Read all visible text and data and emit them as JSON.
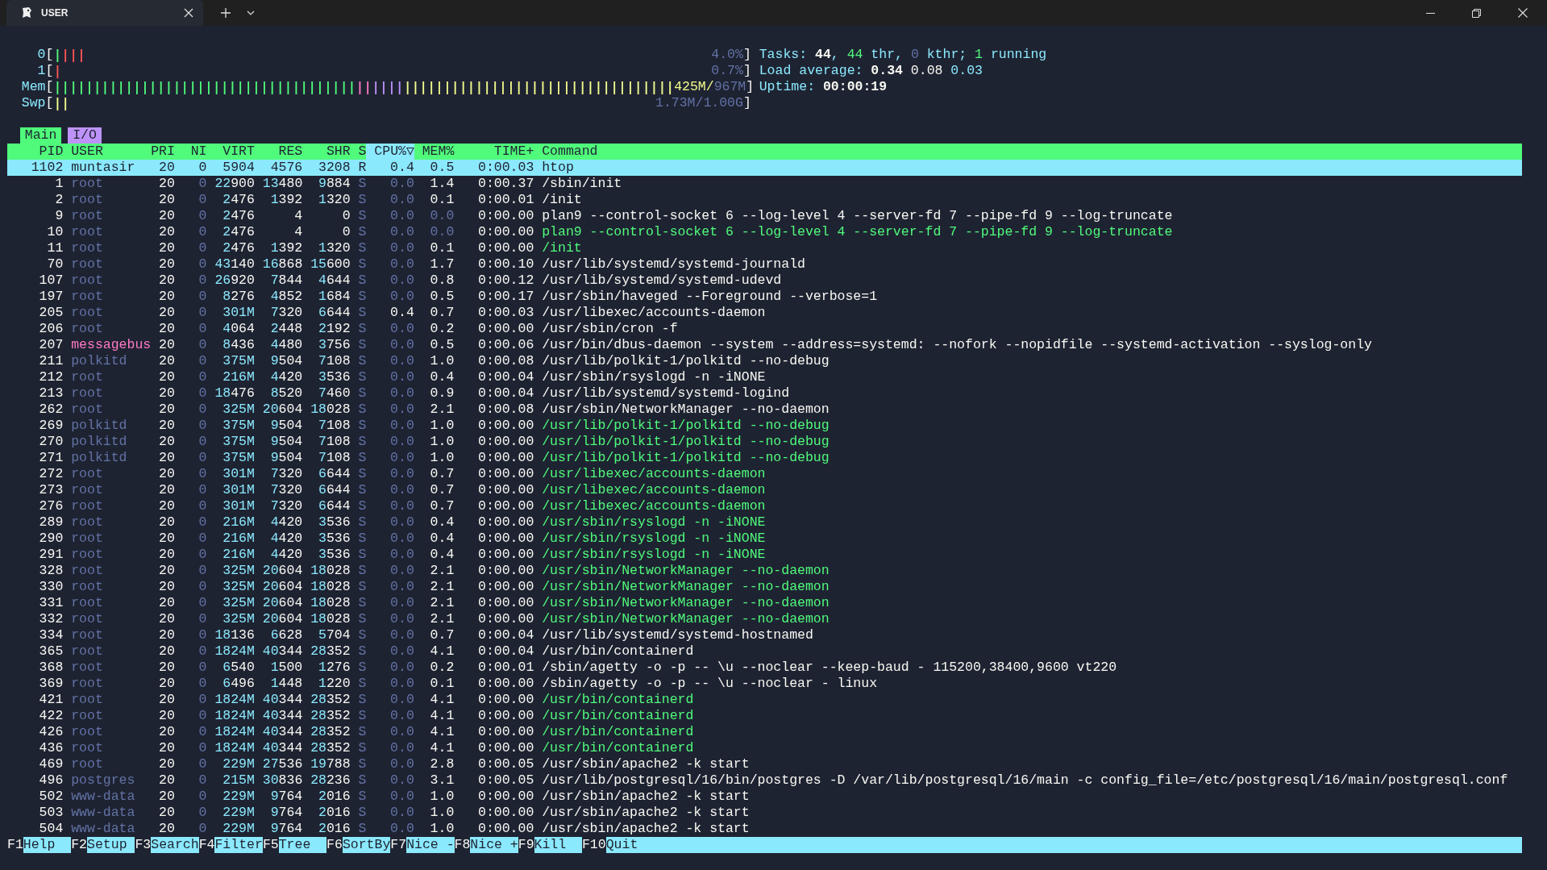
{
  "window": {
    "tab_title": "USER"
  },
  "meters": [
    {
      "label_parts": [
        {
          "text": "0",
          "color": "#8be9fd"
        },
        {
          "text": "[",
          "color": "#f8f8f2"
        }
      ],
      "bar_parts": [
        {
          "text": "|",
          "color": "#50fa7b"
        },
        {
          "text": "|||",
          "color": "#ff5555"
        }
      ],
      "value_parts": [
        {
          "text": "4.0%",
          "color": "#6272a4"
        },
        {
          "text": "]",
          "color": "#f8f8f2"
        }
      ]
    },
    {
      "label_parts": [
        {
          "text": "1",
          "color": "#8be9fd"
        },
        {
          "text": "[",
          "color": "#f8f8f2"
        }
      ],
      "bar_parts": [
        {
          "text": "|",
          "color": "#ff5555"
        }
      ],
      "value_parts": [
        {
          "text": "0.7%",
          "color": "#6272a4"
        },
        {
          "text": "]",
          "color": "#f8f8f2"
        }
      ]
    },
    {
      "label_parts": [
        {
          "text": "Mem",
          "color": "#8be9fd"
        },
        {
          "text": "[",
          "color": "#f8f8f2"
        }
      ],
      "bar_parts": [
        {
          "text": "||||||||||||||||||||||||||||||||||||||",
          "color": "#50fa7b"
        },
        {
          "text": "||",
          "color": "#ff79c6"
        },
        {
          "text": "||||",
          "color": "#bd93f9"
        },
        {
          "text": "||||||||||||||||||||||||||||||||||",
          "color": "#f1fa8c"
        }
      ],
      "value_parts": [
        {
          "text": "425M/",
          "color": "#f1fa8c"
        },
        {
          "text": "967M",
          "color": "#6272a4"
        },
        {
          "text": "]",
          "color": "#f8f8f2"
        }
      ]
    },
    {
      "label_parts": [
        {
          "text": "Swp",
          "color": "#8be9fd"
        },
        {
          "text": "[",
          "color": "#f8f8f2"
        }
      ],
      "bar_parts": [
        {
          "text": "||",
          "color": "#f1fa8c"
        }
      ],
      "value_parts": [
        {
          "text": "1.73M/1.00G",
          "color": "#6272a4"
        },
        {
          "text": "]",
          "color": "#f8f8f2"
        }
      ]
    }
  ],
  "info_lines": [
    [
      {
        "text": "Tasks: ",
        "color": "#8be9fd"
      },
      {
        "text": "44",
        "color": "#f8f8f2"
      },
      {
        "text": ", ",
        "color": "#8be9fd"
      },
      {
        "text": "44",
        "color": "#50fa7b"
      },
      {
        "text": " thr, ",
        "color": "#8be9fd"
      },
      {
        "text": "0",
        "color": "#6272a4"
      },
      {
        "text": " kthr; ",
        "color": "#8be9fd"
      },
      {
        "text": "1",
        "color": "#50fa7b"
      },
      {
        "text": " running",
        "color": "#8be9fd"
      }
    ],
    [
      {
        "text": "Load average: ",
        "color": "#8be9fd"
      },
      {
        "text": "0.34",
        "color": "#f8f8f2"
      },
      {
        "text": " 0.08",
        "color": "#f8f8f2"
      },
      {
        "text": " 0.03",
        "color": "#8be9fd"
      }
    ],
    [
      {
        "text": "Uptime: ",
        "color": "#8be9fd"
      },
      {
        "text": "00:00:19",
        "color": "#f8f8f2"
      }
    ]
  ],
  "tabs": [
    {
      "label": "Main",
      "selected": true
    },
    {
      "label": "I/O",
      "selected": false
    }
  ],
  "columns": [
    {
      "label": "PID",
      "sorted": false
    },
    {
      "label": "USER",
      "sorted": false
    },
    {
      "label": "PRI",
      "sorted": false
    },
    {
      "label": "NI",
      "sorted": false
    },
    {
      "label": "VIRT",
      "sorted": false
    },
    {
      "label": "RES",
      "sorted": false
    },
    {
      "label": "SHR",
      "sorted": false
    },
    {
      "label": "S",
      "sorted": false
    },
    {
      "label": "CPU%▽",
      "sorted": true
    },
    {
      "label": "MEM%",
      "sorted": false
    },
    {
      "label": "TIME+",
      "sorted": false
    },
    {
      "label": "Command",
      "sorted": false
    }
  ],
  "rows": [
    {
      "pid": "1102",
      "user": "muntasir",
      "pri": "20",
      "ni": "0",
      "virt": "5904",
      "res": "4576",
      "shr": "3208",
      "state": "R",
      "cpu": "0.4",
      "mem": "0.5",
      "time": "0:00.03",
      "command": "htop",
      "thread": false,
      "selected": true
    },
    {
      "pid": "1",
      "user": "root",
      "color": "#6272a4",
      "pri": "20",
      "ni": "0",
      "virt": "22900",
      "res": "13480",
      "shr": "9884",
      "state": "S",
      "cpu": "0.0",
      "mem": "1.4",
      "time": "0:00.37",
      "command": "/sbin/init",
      "thread": false,
      "selected": false
    },
    {
      "pid": "2",
      "user": "root",
      "color": "#6272a4",
      "pri": "20",
      "ni": "0",
      "virt": "2476",
      "res": "1392",
      "shr": "1320",
      "state": "S",
      "cpu": "0.0",
      "mem": "0.1",
      "time": "0:00.01",
      "command": "/init",
      "thread": false,
      "selected": false
    },
    {
      "pid": "9",
      "user": "root",
      "color": "#6272a4",
      "pri": "20",
      "ni": "0",
      "virt": "2476",
      "res": "4",
      "shr": "0",
      "state": "S",
      "cpu": "0.0",
      "mem": "0.0",
      "time": "0:00.00",
      "command": "plan9 --control-socket 6 --log-level 4 --server-fd 7 --pipe-fd 9 --log-truncate",
      "thread": false,
      "selected": false
    },
    {
      "pid": "10",
      "user": "root",
      "color": "#6272a4",
      "pri": "20",
      "ni": "0",
      "virt": "2476",
      "res": "4",
      "shr": "0",
      "state": "S",
      "cpu": "0.0",
      "mem": "0.0",
      "time": "0:00.00",
      "command": "plan9 --control-socket 6 --log-level 4 --server-fd 7 --pipe-fd 9 --log-truncate",
      "thread": true,
      "selected": false
    },
    {
      "pid": "11",
      "user": "root",
      "color": "#6272a4",
      "pri": "20",
      "ni": "0",
      "virt": "2476",
      "res": "1392",
      "shr": "1320",
      "state": "S",
      "cpu": "0.0",
      "mem": "0.1",
      "time": "0:00.00",
      "command": "/init",
      "thread": true,
      "selected": false
    },
    {
      "pid": "70",
      "user": "root",
      "color": "#6272a4",
      "pri": "20",
      "ni": "0",
      "virt": "43140",
      "res": "16868",
      "shr": "15600",
      "state": "S",
      "cpu": "0.0",
      "mem": "1.7",
      "time": "0:00.10",
      "command": "/usr/lib/systemd/systemd-journald",
      "thread": false,
      "selected": false
    },
    {
      "pid": "107",
      "user": "root",
      "color": "#6272a4",
      "pri": "20",
      "ni": "0",
      "virt": "26920",
      "res": "7844",
      "shr": "4644",
      "state": "S",
      "cpu": "0.0",
      "mem": "0.8",
      "time": "0:00.12",
      "command": "/usr/lib/systemd/systemd-udevd",
      "thread": false,
      "selected": false
    },
    {
      "pid": "197",
      "user": "root",
      "color": "#6272a4",
      "pri": "20",
      "ni": "0",
      "virt": "8276",
      "res": "4852",
      "shr": "1684",
      "state": "S",
      "cpu": "0.0",
      "mem": "0.5",
      "time": "0:00.17",
      "command": "/usr/sbin/haveged --Foreground --verbose=1",
      "thread": false,
      "selected": false
    },
    {
      "pid": "205",
      "user": "root",
      "color": "#6272a4",
      "pri": "20",
      "ni": "0",
      "virt": "301M",
      "res": "7320",
      "shr": "6644",
      "state": "S",
      "cpu": "0.4",
      "mem": "0.7",
      "time": "0:00.03",
      "command": "/usr/libexec/accounts-daemon",
      "thread": false,
      "selected": false
    },
    {
      "pid": "206",
      "user": "root",
      "color": "#6272a4",
      "pri": "20",
      "ni": "0",
      "virt": "4064",
      "res": "2448",
      "shr": "2192",
      "state": "S",
      "cpu": "0.0",
      "mem": "0.2",
      "time": "0:00.00",
      "command": "/usr/sbin/cron -f",
      "thread": false,
      "selected": false
    },
    {
      "pid": "207",
      "user": "messagebus",
      "color": "#ff79c6",
      "pri": "20",
      "ni": "0",
      "virt": "8436",
      "res": "4480",
      "shr": "3756",
      "state": "S",
      "cpu": "0.0",
      "mem": "0.5",
      "time": "0:00.06",
      "command": "/usr/bin/dbus-daemon --system --address=systemd: --nofork --nopidfile --systemd-activation --syslog-only",
      "thread": false,
      "selected": false
    },
    {
      "pid": "211",
      "user": "polkitd",
      "color": "#6272a4",
      "pri": "20",
      "ni": "0",
      "virt": "375M",
      "res": "9504",
      "shr": "7108",
      "state": "S",
      "cpu": "0.0",
      "mem": "1.0",
      "time": "0:00.08",
      "command": "/usr/lib/polkit-1/polkitd --no-debug",
      "thread": false,
      "selected": false
    },
    {
      "pid": "212",
      "user": "root",
      "color": "#6272a4",
      "pri": "20",
      "ni": "0",
      "virt": "216M",
      "res": "4420",
      "shr": "3536",
      "state": "S",
      "cpu": "0.0",
      "mem": "0.4",
      "time": "0:00.04",
      "command": "/usr/sbin/rsyslogd -n -iNONE",
      "thread": false,
      "selected": false
    },
    {
      "pid": "213",
      "user": "root",
      "color": "#6272a4",
      "pri": "20",
      "ni": "0",
      "virt": "18476",
      "res": "8520",
      "shr": "7460",
      "state": "S",
      "cpu": "0.0",
      "mem": "0.9",
      "time": "0:00.04",
      "command": "/usr/lib/systemd/systemd-logind",
      "thread": false,
      "selected": false
    },
    {
      "pid": "262",
      "user": "root",
      "color": "#6272a4",
      "pri": "20",
      "ni": "0",
      "virt": "325M",
      "res": "20604",
      "shr": "18028",
      "state": "S",
      "cpu": "0.0",
      "mem": "2.1",
      "time": "0:00.08",
      "command": "/usr/sbin/NetworkManager --no-daemon",
      "thread": false,
      "selected": false
    },
    {
      "pid": "269",
      "user": "polkitd",
      "color": "#6272a4",
      "pri": "20",
      "ni": "0",
      "virt": "375M",
      "res": "9504",
      "shr": "7108",
      "state": "S",
      "cpu": "0.0",
      "mem": "1.0",
      "time": "0:00.00",
      "command": "/usr/lib/polkit-1/polkitd --no-debug",
      "thread": true,
      "selected": false
    },
    {
      "pid": "270",
      "user": "polkitd",
      "color": "#6272a4",
      "pri": "20",
      "ni": "0",
      "virt": "375M",
      "res": "9504",
      "shr": "7108",
      "state": "S",
      "cpu": "0.0",
      "mem": "1.0",
      "time": "0:00.00",
      "command": "/usr/lib/polkit-1/polkitd --no-debug",
      "thread": true,
      "selected": false
    },
    {
      "pid": "271",
      "user": "polkitd",
      "color": "#6272a4",
      "pri": "20",
      "ni": "0",
      "virt": "375M",
      "res": "9504",
      "shr": "7108",
      "state": "S",
      "cpu": "0.0",
      "mem": "1.0",
      "time": "0:00.00",
      "command": "/usr/lib/polkit-1/polkitd --no-debug",
      "thread": true,
      "selected": false
    },
    {
      "pid": "272",
      "user": "root",
      "color": "#6272a4",
      "pri": "20",
      "ni": "0",
      "virt": "301M",
      "res": "7320",
      "shr": "6644",
      "state": "S",
      "cpu": "0.0",
      "mem": "0.7",
      "time": "0:00.00",
      "command": "/usr/libexec/accounts-daemon",
      "thread": true,
      "selected": false
    },
    {
      "pid": "273",
      "user": "root",
      "color": "#6272a4",
      "pri": "20",
      "ni": "0",
      "virt": "301M",
      "res": "7320",
      "shr": "6644",
      "state": "S",
      "cpu": "0.0",
      "mem": "0.7",
      "time": "0:00.00",
      "command": "/usr/libexec/accounts-daemon",
      "thread": true,
      "selected": false
    },
    {
      "pid": "276",
      "user": "root",
      "color": "#6272a4",
      "pri": "20",
      "ni": "0",
      "virt": "301M",
      "res": "7320",
      "shr": "6644",
      "state": "S",
      "cpu": "0.0",
      "mem": "0.7",
      "time": "0:00.00",
      "command": "/usr/libexec/accounts-daemon",
      "thread": true,
      "selected": false
    },
    {
      "pid": "289",
      "user": "root",
      "color": "#6272a4",
      "pri": "20",
      "ni": "0",
      "virt": "216M",
      "res": "4420",
      "shr": "3536",
      "state": "S",
      "cpu": "0.0",
      "mem": "0.4",
      "time": "0:00.00",
      "command": "/usr/sbin/rsyslogd -n -iNONE",
      "thread": true,
      "selected": false
    },
    {
      "pid": "290",
      "user": "root",
      "color": "#6272a4",
      "pri": "20",
      "ni": "0",
      "virt": "216M",
      "res": "4420",
      "shr": "3536",
      "state": "S",
      "cpu": "0.0",
      "mem": "0.4",
      "time": "0:00.00",
      "command": "/usr/sbin/rsyslogd -n -iNONE",
      "thread": true,
      "selected": false
    },
    {
      "pid": "291",
      "user": "root",
      "color": "#6272a4",
      "pri": "20",
      "ni": "0",
      "virt": "216M",
      "res": "4420",
      "shr": "3536",
      "state": "S",
      "cpu": "0.0",
      "mem": "0.4",
      "time": "0:00.00",
      "command": "/usr/sbin/rsyslogd -n -iNONE",
      "thread": true,
      "selected": false
    },
    {
      "pid": "328",
      "user": "root",
      "color": "#6272a4",
      "pri": "20",
      "ni": "0",
      "virt": "325M",
      "res": "20604",
      "shr": "18028",
      "state": "S",
      "cpu": "0.0",
      "mem": "2.1",
      "time": "0:00.00",
      "command": "/usr/sbin/NetworkManager --no-daemon",
      "thread": true,
      "selected": false
    },
    {
      "pid": "330",
      "user": "root",
      "color": "#6272a4",
      "pri": "20",
      "ni": "0",
      "virt": "325M",
      "res": "20604",
      "shr": "18028",
      "state": "S",
      "cpu": "0.0",
      "mem": "2.1",
      "time": "0:00.00",
      "command": "/usr/sbin/NetworkManager --no-daemon",
      "thread": true,
      "selected": false
    },
    {
      "pid": "331",
      "user": "root",
      "color": "#6272a4",
      "pri": "20",
      "ni": "0",
      "virt": "325M",
      "res": "20604",
      "shr": "18028",
      "state": "S",
      "cpu": "0.0",
      "mem": "2.1",
      "time": "0:00.00",
      "command": "/usr/sbin/NetworkManager --no-daemon",
      "thread": true,
      "selected": false
    },
    {
      "pid": "332",
      "user": "root",
      "color": "#6272a4",
      "pri": "20",
      "ni": "0",
      "virt": "325M",
      "res": "20604",
      "shr": "18028",
      "state": "S",
      "cpu": "0.0",
      "mem": "2.1",
      "time": "0:00.00",
      "command": "/usr/sbin/NetworkManager --no-daemon",
      "thread": true,
      "selected": false
    },
    {
      "pid": "334",
      "user": "root",
      "color": "#6272a4",
      "pri": "20",
      "ni": "0",
      "virt": "18136",
      "res": "6628",
      "shr": "5704",
      "state": "S",
      "cpu": "0.0",
      "mem": "0.7",
      "time": "0:00.04",
      "command": "/usr/lib/systemd/systemd-hostnamed",
      "thread": false,
      "selected": false
    },
    {
      "pid": "365",
      "user": "root",
      "color": "#6272a4",
      "pri": "20",
      "ni": "0",
      "virt": "1824M",
      "res": "40344",
      "shr": "28352",
      "state": "S",
      "cpu": "0.0",
      "mem": "4.1",
      "time": "0:00.04",
      "command": "/usr/bin/containerd",
      "thread": false,
      "selected": false
    },
    {
      "pid": "368",
      "user": "root",
      "color": "#6272a4",
      "pri": "20",
      "ni": "0",
      "virt": "6540",
      "res": "1500",
      "shr": "1276",
      "state": "S",
      "cpu": "0.0",
      "mem": "0.2",
      "time": "0:00.01",
      "command": "/sbin/agetty -o -p -- \\u --noclear --keep-baud - 115200,38400,9600 vt220",
      "thread": false,
      "selected": false
    },
    {
      "pid": "369",
      "user": "root",
      "color": "#6272a4",
      "pri": "20",
      "ni": "0",
      "virt": "6496",
      "res": "1448",
      "shr": "1220",
      "state": "S",
      "cpu": "0.0",
      "mem": "0.1",
      "time": "0:00.00",
      "command": "/sbin/agetty -o -p -- \\u --noclear - linux",
      "thread": false,
      "selected": false
    },
    {
      "pid": "421",
      "user": "root",
      "color": "#6272a4",
      "pri": "20",
      "ni": "0",
      "virt": "1824M",
      "res": "40344",
      "shr": "28352",
      "state": "S",
      "cpu": "0.0",
      "mem": "4.1",
      "time": "0:00.00",
      "command": "/usr/bin/containerd",
      "thread": true,
      "selected": false
    },
    {
      "pid": "422",
      "user": "root",
      "color": "#6272a4",
      "pri": "20",
      "ni": "0",
      "virt": "1824M",
      "res": "40344",
      "shr": "28352",
      "state": "S",
      "cpu": "0.0",
      "mem": "4.1",
      "time": "0:00.00",
      "command": "/usr/bin/containerd",
      "thread": true,
      "selected": false
    },
    {
      "pid": "426",
      "user": "root",
      "color": "#6272a4",
      "pri": "20",
      "ni": "0",
      "virt": "1824M",
      "res": "40344",
      "shr": "28352",
      "state": "S",
      "cpu": "0.0",
      "mem": "4.1",
      "time": "0:00.00",
      "command": "/usr/bin/containerd",
      "thread": true,
      "selected": false
    },
    {
      "pid": "436",
      "user": "root",
      "color": "#6272a4",
      "pri": "20",
      "ni": "0",
      "virt": "1824M",
      "res": "40344",
      "shr": "28352",
      "state": "S",
      "cpu": "0.0",
      "mem": "4.1",
      "time": "0:00.00",
      "command": "/usr/bin/containerd",
      "thread": true,
      "selected": false
    },
    {
      "pid": "469",
      "user": "root",
      "color": "#6272a4",
      "pri": "20",
      "ni": "0",
      "virt": "229M",
      "res": "27536",
      "shr": "19788",
      "state": "S",
      "cpu": "0.0",
      "mem": "2.8",
      "time": "0:00.05",
      "command": "/usr/sbin/apache2 -k start",
      "thread": false,
      "selected": false
    },
    {
      "pid": "496",
      "user": "postgres",
      "color": "#6272a4",
      "pri": "20",
      "ni": "0",
      "virt": "215M",
      "res": "30836",
      "shr": "28236",
      "state": "S",
      "cpu": "0.0",
      "mem": "3.1",
      "time": "0:00.05",
      "command": "/usr/lib/postgresql/16/bin/postgres -D /var/lib/postgresql/16/main -c config_file=/etc/postgresql/16/main/postgresql.conf",
      "thread": false,
      "selected": false
    },
    {
      "pid": "502",
      "user": "www-data",
      "color": "#6272a4",
      "pri": "20",
      "ni": "0",
      "virt": "229M",
      "res": "9764",
      "shr": "2016",
      "state": "S",
      "cpu": "0.0",
      "mem": "1.0",
      "time": "0:00.00",
      "command": "/usr/sbin/apache2 -k start",
      "thread": false,
      "selected": false
    },
    {
      "pid": "503",
      "user": "www-data",
      "color": "#6272a4",
      "pri": "20",
      "ni": "0",
      "virt": "229M",
      "res": "9764",
      "shr": "2016",
      "state": "S",
      "cpu": "0.0",
      "mem": "1.0",
      "time": "0:00.00",
      "command": "/usr/sbin/apache2 -k start",
      "thread": false,
      "selected": false
    },
    {
      "pid": "504",
      "user": "www-data",
      "color": "#6272a4",
      "pri": "20",
      "ni": "0",
      "virt": "229M",
      "res": "9764",
      "shr": "2016",
      "state": "S",
      "cpu": "0.0",
      "mem": "1.0",
      "time": "0:00.00",
      "command": "/usr/sbin/apache2 -k start",
      "thread": false,
      "selected": false
    }
  ],
  "function_keys": [
    {
      "key": "F1",
      "label": "Help"
    },
    {
      "key": "F2",
      "label": "Setup"
    },
    {
      "key": "F3",
      "label": "Search"
    },
    {
      "key": "F4",
      "label": "Filter"
    },
    {
      "key": "F5",
      "label": "Tree"
    },
    {
      "key": "F6",
      "label": "SortBy"
    },
    {
      "key": "F7",
      "label": "Nice -"
    },
    {
      "key": "F8",
      "label": "Nice +"
    },
    {
      "key": "F9",
      "label": "Kill"
    },
    {
      "key": "F10",
      "label": "Quit"
    }
  ]
}
